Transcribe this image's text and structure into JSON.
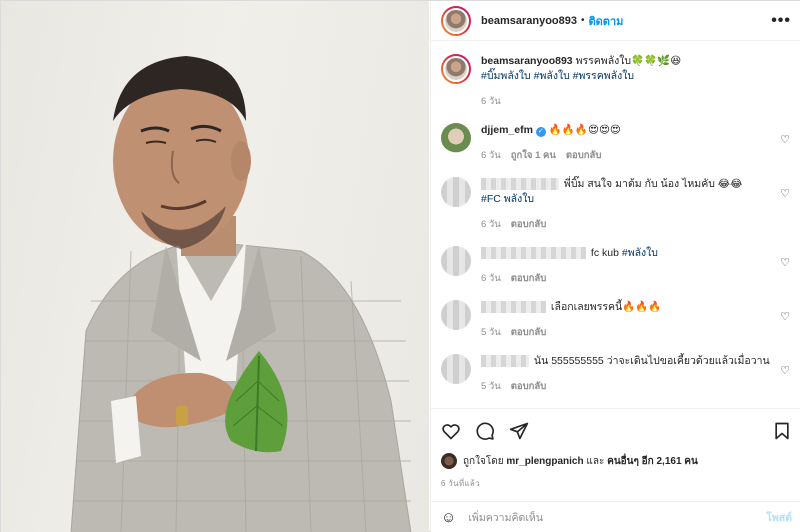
{
  "header": {
    "username": "beamsaranyoo893",
    "separator": "•",
    "follow_label": "ติดตาม",
    "more_label": "•••"
  },
  "caption": {
    "username": "beamsaranyoo893",
    "text": "พรรคพลังใบ🍀🍀🌿😆",
    "hashtags": "#บิ๊มพลังใบ #พลังใบ #พรรคพลังใบ",
    "time": "6 วัน"
  },
  "comments": [
    {
      "username": "djjem_efm",
      "verified": true,
      "text": "🔥🔥🔥😍😍😍",
      "time": "6 วัน",
      "likes": "ถูกใจ 1 คน",
      "reply": "ตอบกลับ"
    },
    {
      "username": "",
      "text": "พี่บิ๊ม สนใจ มาต้ม กับ น้อง ไหมคับ 😂😂",
      "hashtag": "#FC พลังใบ",
      "time": "6 วัน",
      "reply": "ตอบกลับ"
    },
    {
      "username": "",
      "text": "fc kub",
      "hashtag": "#พลังใบ",
      "time": "6 วัน",
      "reply": "ตอบกลับ"
    },
    {
      "username": "",
      "text": "เลือกเลยพรรคนี้🔥🔥🔥",
      "time": "5 วัน",
      "reply": "ตอบกลับ"
    },
    {
      "username": "",
      "text": "นัน 555555555 ว่าจะเดินไปขอเคี้ยวด้วยแล้วเมื่อวาน",
      "time": "5 วัน",
      "reply": "ตอบกลับ"
    }
  ],
  "actions": {
    "icons": [
      "heart-icon",
      "comment-icon",
      "share-icon",
      "bookmark-icon"
    ]
  },
  "likes": {
    "prefix": "ถูกใจโดย",
    "user": "mr_plengpanich",
    "middle": "และ",
    "others": "คนอื่นๆ อีก 2,161 คน"
  },
  "posted_ago": "6 วันที่แล้ว",
  "add_comment": {
    "placeholder": "เพิ่มความคิดเห็น",
    "post_label": "โพสต์"
  }
}
